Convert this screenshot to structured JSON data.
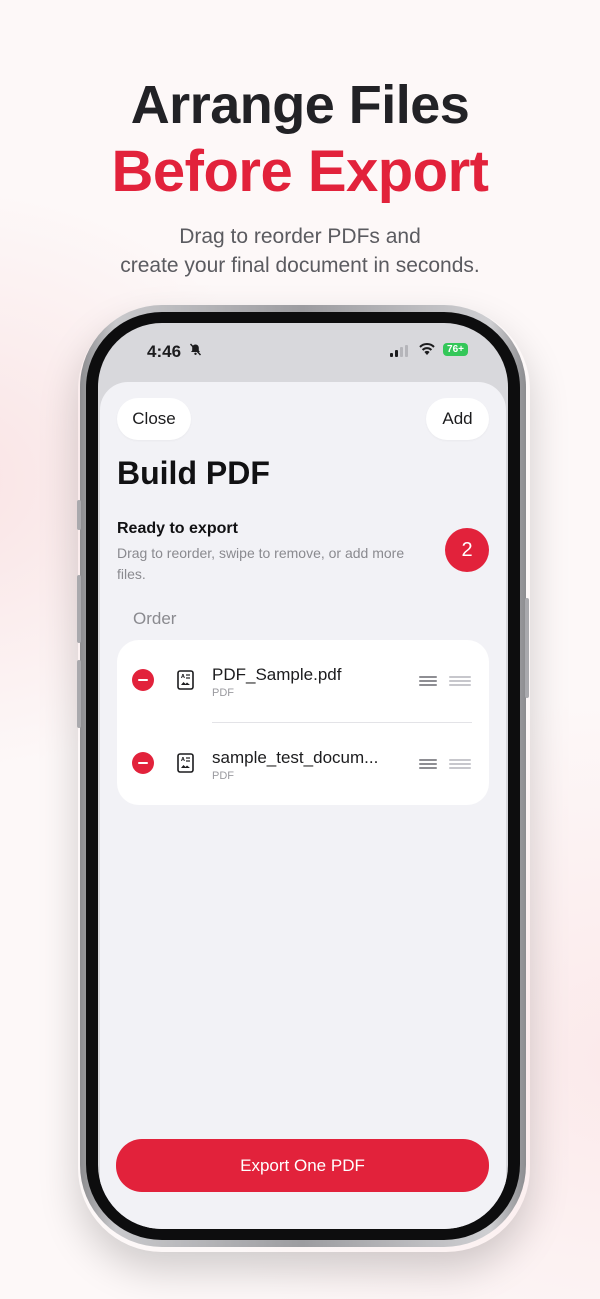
{
  "hero": {
    "line1": "Arrange Files",
    "line2": "Before Export",
    "subtitle_line1": "Drag to reorder PDFs and",
    "subtitle_line2": "create your final document in seconds."
  },
  "status_bar": {
    "time": "4:46",
    "battery": "76+",
    "icons": [
      "bell-slash-icon",
      "signal-icon",
      "wifi-icon",
      "battery-icon"
    ]
  },
  "sheet": {
    "close_label": "Close",
    "add_label": "Add",
    "title": "Build PDF",
    "ready_title": "Ready to export",
    "ready_desc": "Drag to reorder, swipe to remove, or add more files.",
    "count": "2",
    "order_label": "Order",
    "files": [
      {
        "name": "PDF_Sample.pdf",
        "type": "PDF"
      },
      {
        "name": "sample_test_docum...",
        "type": "PDF"
      }
    ],
    "export_label": "Export One PDF"
  },
  "colors": {
    "accent": "#e2223b",
    "title": "#222226",
    "sheet_bg": "#f2f2f6"
  }
}
